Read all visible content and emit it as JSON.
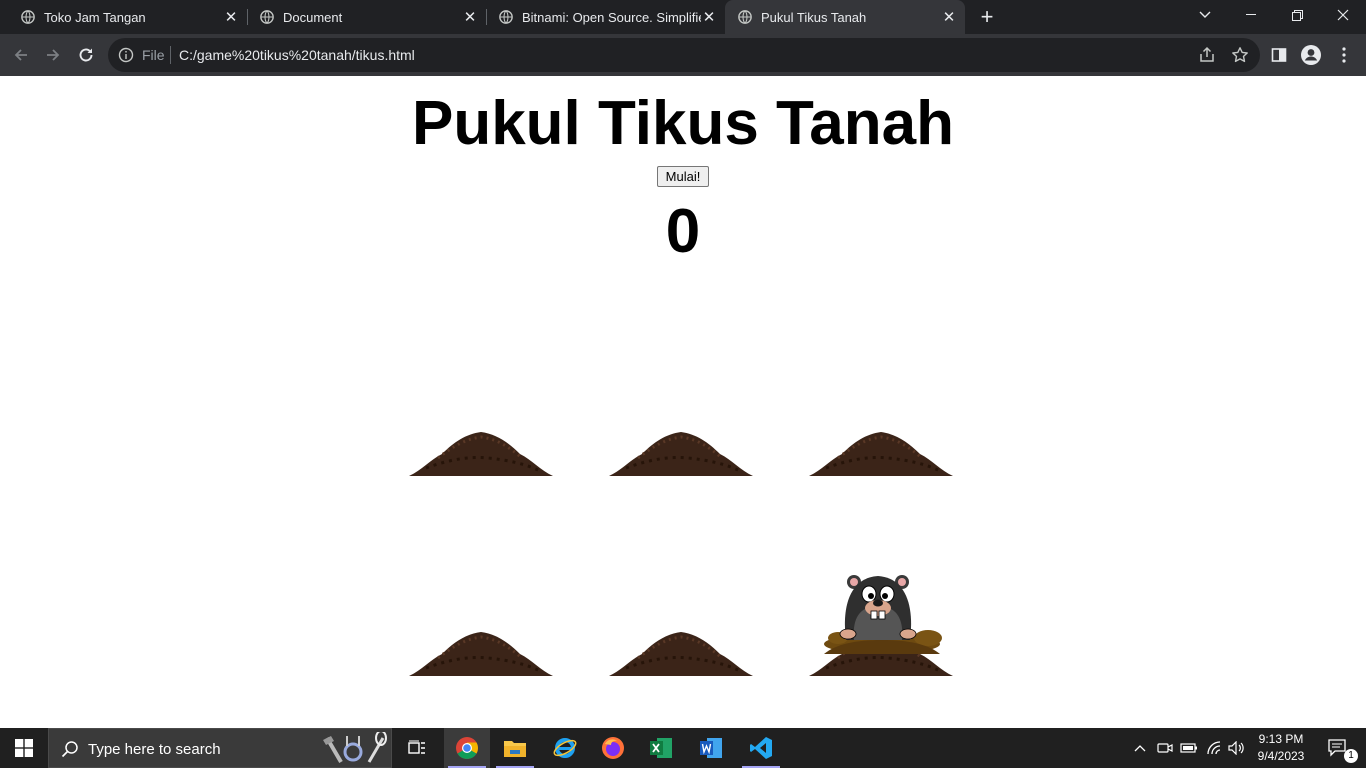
{
  "browser": {
    "tabs": [
      {
        "title": "Toko Jam Tangan",
        "active": false
      },
      {
        "title": "Document",
        "active": false
      },
      {
        "title": "Bitnami: Open Source. Simplified",
        "active": false
      },
      {
        "title": "Pukul Tikus Tanah",
        "active": true
      }
    ],
    "address": {
      "scheme_label": "File",
      "url": "C:/game%20tikus%20tanah/tikus.html"
    }
  },
  "game": {
    "title": "Pukul Tikus Tanah",
    "start_label": "Mulai!",
    "score": "0",
    "holes": [
      {
        "mole_visible": false
      },
      {
        "mole_visible": false
      },
      {
        "mole_visible": false
      },
      {
        "mole_visible": false
      },
      {
        "mole_visible": false
      },
      {
        "mole_visible": true
      }
    ]
  },
  "taskbar": {
    "search_placeholder": "Type here to search",
    "apps": [
      "task-view",
      "chrome",
      "file-explorer",
      "edge",
      "firefox",
      "excel",
      "word",
      "vscode"
    ],
    "time": "9:13 PM",
    "date": "9/4/2023",
    "notification_count": "1"
  },
  "colors": {
    "tabstrip": "#202124",
    "toolbar": "#35363a",
    "soil": "#3b2418",
    "taskbar": "#202020"
  }
}
